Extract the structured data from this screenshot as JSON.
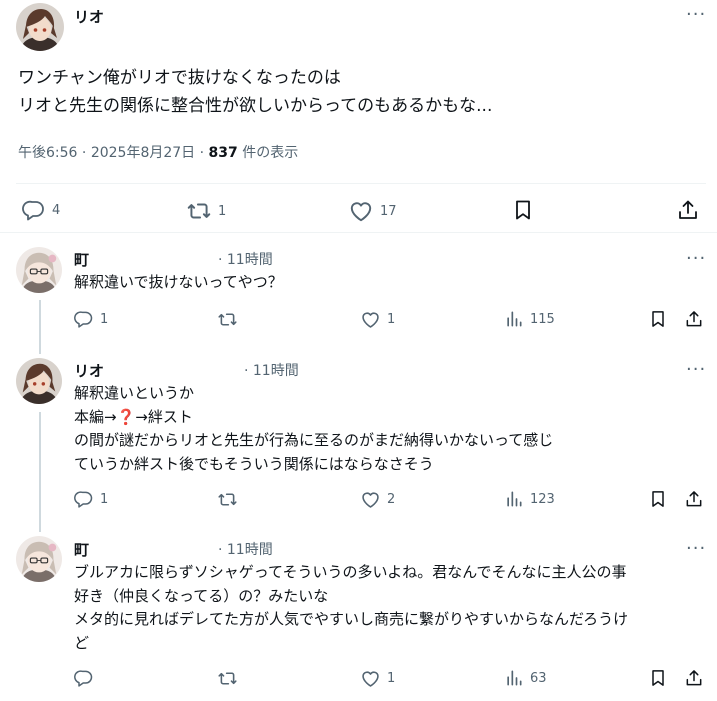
{
  "main_post": {
    "author": "リオ",
    "more": "···",
    "lines": [
      "ワンチャン俺がリオで抜けなくなったのは",
      "リオと先生の関係に整合性が欲しいからってのもあるかもな..."
    ],
    "time": "午後6:56",
    "date": "2025年8月27日",
    "views_count": "837",
    "views_label": "件の表示",
    "sep": "·",
    "replies": "4",
    "reposts": "1",
    "likes": "17"
  },
  "replies": [
    {
      "author": "町",
      "time": "· 11時間",
      "lines": [
        "解釈違いで抜けないってやつ？"
      ],
      "replies": "1",
      "reposts": "",
      "likes": "1",
      "views": "115"
    },
    {
      "author": "リオ",
      "time": "· 11時間",
      "lines": [
        "解釈違いというか",
        "本編→",
        "→絆スト",
        "の間が謎だからリオと先生が行為に至るのがまだ納得いかないって感じ",
        "ていうか絆スト後でもそういう関係にはならなさそう"
      ],
      "replies": "1",
      "reposts": "",
      "likes": "2",
      "views": "123"
    },
    {
      "author": "町",
      "time": "· 11時間",
      "lines": [
        "ブルアカに限らずソシャゲってそういうの多いよね。君なんでそんなに主人公の事",
        "好き（仲良くなってる）の？みたいな",
        "メタ的に見ればデレてた方が人気でやすいし商売に繋がりやすいからなんだろうけ",
        "ど"
      ],
      "replies": "",
      "reposts": "",
      "likes": "1",
      "views": "63"
    }
  ],
  "icons": {
    "reply": "reply-icon",
    "repost": "repost-icon",
    "like": "heart-icon",
    "views": "views-icon",
    "bookmark": "bookmark-icon",
    "share": "share-icon",
    "question": "❓"
  },
  "colors": {
    "text": "#0f1419",
    "muted": "#536471",
    "border": "#eff3f4",
    "question_red": "#e0245e"
  }
}
